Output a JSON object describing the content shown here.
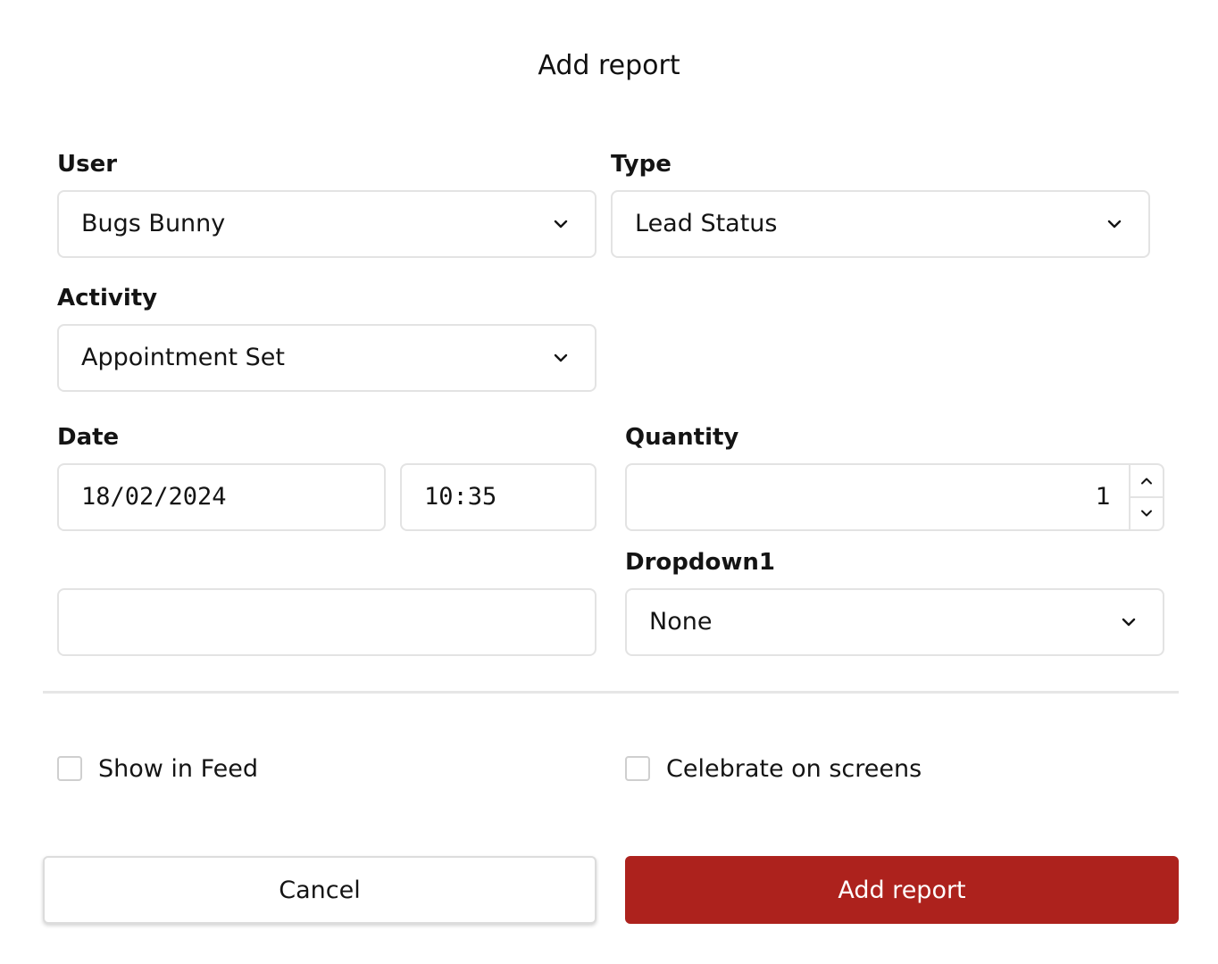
{
  "dialog": {
    "title": "Add report"
  },
  "form": {
    "user": {
      "label": "User",
      "value": "Bugs Bunny"
    },
    "type": {
      "label": "Type",
      "value": "Lead Status"
    },
    "activity": {
      "label": "Activity",
      "value": "Appointment Set"
    },
    "date": {
      "label": "Date",
      "date_value": "18/02/2024",
      "time_value": "10:35"
    },
    "quantity": {
      "label": "Quantity",
      "value": "1"
    },
    "dropdown1": {
      "label": "Dropdown1",
      "value": "None"
    },
    "notes": {
      "value": ""
    }
  },
  "options": {
    "show_in_feed": {
      "label": "Show in Feed",
      "checked": false
    },
    "celebrate_on_screens": {
      "label": "Celebrate on screens",
      "checked": false
    }
  },
  "actions": {
    "cancel_label": "Cancel",
    "submit_label": "Add report"
  },
  "colors": {
    "primary": "#ad221d",
    "border": "#e3e3e3",
    "text": "#141414"
  },
  "icons": {
    "dropdown": "chevron-down-icon",
    "increment": "chevron-up-icon",
    "decrement": "chevron-down-icon"
  }
}
